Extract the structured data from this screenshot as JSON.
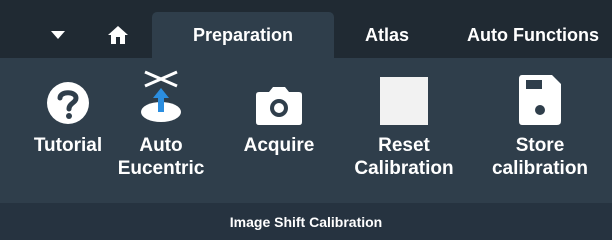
{
  "tabs": {
    "preparation": "Preparation",
    "atlas": "Atlas",
    "auto_functions": "Auto Functions"
  },
  "ribbon": {
    "tools": {
      "tutorial": "Tutorial",
      "auto_eucentric": "Auto\nEucentric",
      "acquire": "Acquire",
      "reset_calibration": "Reset\nCalibration",
      "store_calibration": "Store\ncalibration"
    },
    "group_title": "Image Shift Calibration"
  },
  "icons": {
    "dropdown": "caret-down-icon",
    "home": "home-icon",
    "tutorial": "question-icon",
    "auto_eucentric": "eucentric-icon",
    "acquire": "camera-icon",
    "reset_calibration": "reset-icon",
    "store_calibration": "save-icon"
  },
  "colors": {
    "tabbar": "#202a33",
    "panel": "#2f3e4b",
    "footer": "#263340",
    "accent_blue": "#2b8ee0",
    "icon": "#ffffff"
  }
}
